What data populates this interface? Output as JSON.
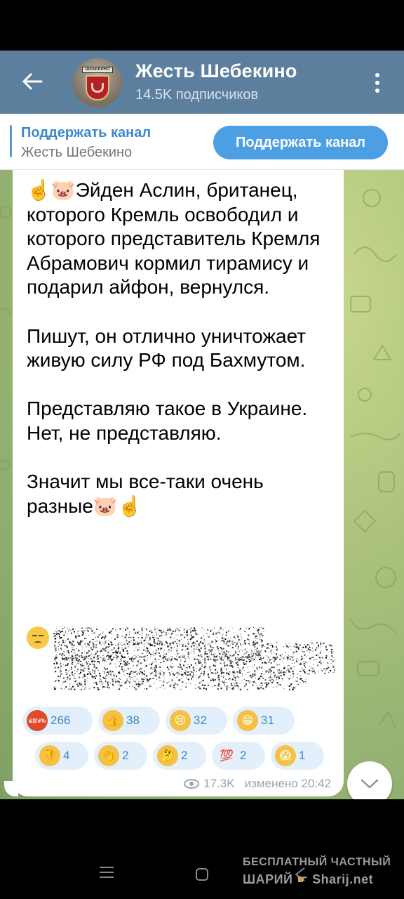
{
  "header": {
    "title": "Жесть Шебекино",
    "subscribers": "14.5K подписчиков",
    "avatar_banner_text": "ШЕБЕКИНО"
  },
  "pinned": {
    "title": "Поддержать канал",
    "subtitle": "Жесть Шебекино",
    "button_label": "Поддержать канал"
  },
  "message": {
    "text": "☝️🐷Эйден Аслин, британец, которого Кремль освободил и которого представитель Кремля Абрамович кормил тирамису и подарил айфон, вернулся.\n\nПишут, он отлично уничтожает живую силу РФ под Бахмутом.\n\nПредставляю такое в Украине. Нет, не представляю.\n\nЗначит мы все-таки очень разные🐷☝️",
    "spoiler_emoji": "😔",
    "views": "17.3K",
    "status": "изменено 20:42"
  },
  "reactions": [
    {
      "emoji": "angry-face-icon",
      "glyph": "&$!#%",
      "count": "266",
      "color": "#e04a2a"
    },
    {
      "emoji": "thumbs-up-icon",
      "glyph": "👍",
      "count": "38",
      "color": "#f5c043"
    },
    {
      "emoji": "crying-face-icon",
      "glyph": "😢",
      "count": "32",
      "color": "#f5c043"
    },
    {
      "emoji": "grinning-face-icon",
      "glyph": "😁",
      "count": "31",
      "color": "#f5c043"
    },
    {
      "emoji": "thumbs-down-icon",
      "glyph": "👎",
      "count": "4",
      "color": "#f5c043"
    },
    {
      "emoji": "clapping-hands-icon",
      "glyph": "👏",
      "count": "2",
      "color": "#f5c043"
    },
    {
      "emoji": "thinking-face-icon",
      "glyph": "🤔",
      "count": "2",
      "color": "#f5c043"
    },
    {
      "emoji": "hundred-points-icon",
      "glyph": "💯",
      "count": "2",
      "color": "#e84040"
    },
    {
      "emoji": "screaming-face-icon",
      "glyph": "😱",
      "count": "1",
      "color": "#f5c043"
    }
  ],
  "watermark": {
    "line1": "БЕСПЛАТНЫЙ ЧАСТНЫЙ",
    "line2": "ШАРИЙ",
    "line3": "Sharij.net"
  },
  "colors": {
    "header_bg": "#5d7f9e",
    "accent": "#4b9fe2",
    "reaction_bg": "#e3f0fb",
    "arrow": "#e8364f"
  }
}
